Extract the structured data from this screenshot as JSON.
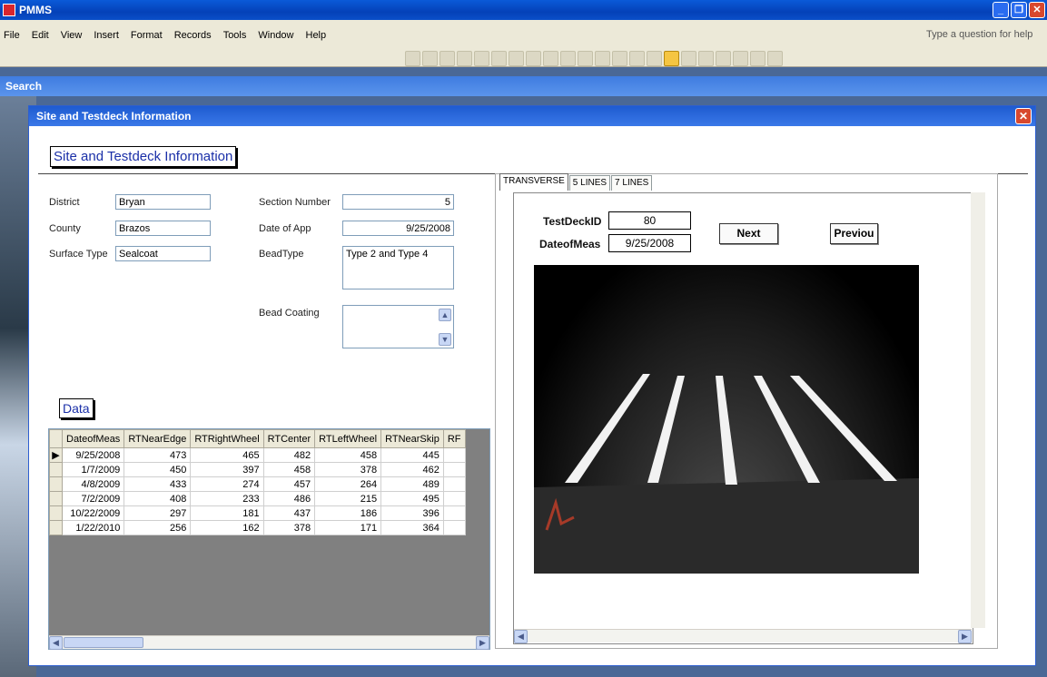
{
  "app": {
    "title": "PMMS"
  },
  "menu": {
    "items": [
      "File",
      "Edit",
      "View",
      "Insert",
      "Format",
      "Records",
      "Tools",
      "Window",
      "Help"
    ],
    "ask": "Type a question for help"
  },
  "search_window": {
    "title": "Search"
  },
  "form": {
    "title": "Site and Testdeck Information",
    "heading": "Site and Testdeck Information",
    "fields": {
      "district": {
        "label": "District",
        "value": "Bryan"
      },
      "county": {
        "label": "County",
        "value": "Brazos"
      },
      "surface_type": {
        "label": "Surface Type",
        "value": "Sealcoat"
      },
      "section_number": {
        "label": "Section Number",
        "value": "5"
      },
      "date_of_app": {
        "label": "Date of App",
        "value": "9/25/2008"
      },
      "bead_type": {
        "label": "BeadType",
        "value": "Type 2 and Type 4"
      },
      "bead_coating": {
        "label": "Bead Coating",
        "value": ""
      }
    },
    "data_heading": "Data",
    "grid": {
      "columns": [
        "DateofMeas",
        "RTNearEdge",
        "RTRightWheel",
        "RTCenter",
        "RTLeftWheel",
        "RTNearSkip",
        "RF"
      ],
      "rows": [
        [
          "9/25/2008",
          "473",
          "465",
          "482",
          "458",
          "445"
        ],
        [
          "1/7/2009",
          "450",
          "397",
          "458",
          "378",
          "462"
        ],
        [
          "4/8/2009",
          "433",
          "274",
          "457",
          "264",
          "489"
        ],
        [
          "7/2/2009",
          "408",
          "233",
          "486",
          "215",
          "495"
        ],
        [
          "10/22/2009",
          "297",
          "181",
          "437",
          "186",
          "396"
        ],
        [
          "1/22/2010",
          "256",
          "162",
          "378",
          "171",
          "364"
        ]
      ]
    },
    "tabs": [
      "TRANSVERSE",
      "5 LINES",
      "7 LINES"
    ],
    "detail": {
      "test_deck_id": {
        "label": "TestDeckID",
        "value": "80"
      },
      "date_of_meas": {
        "label": "DateofMeas",
        "value": "9/25/2008"
      },
      "next_label": "Next",
      "prev_label": "Previou"
    }
  }
}
